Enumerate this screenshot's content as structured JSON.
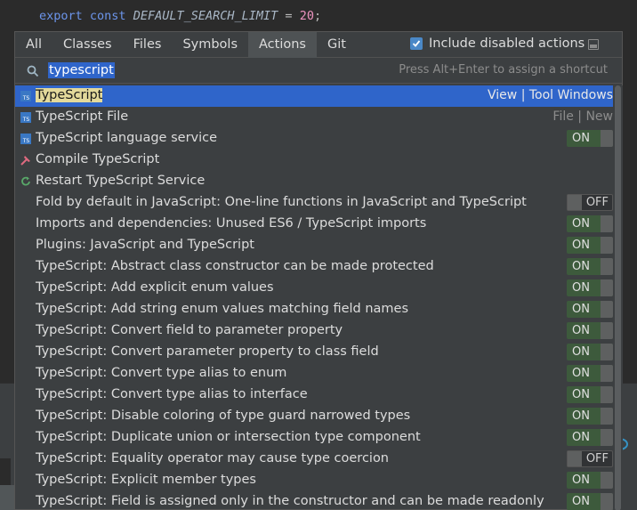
{
  "editor": {
    "keyword1": "export",
    "keyword2": "const",
    "const_name": "DEFAULT_SEARCH_LIMIT",
    "operator": "=",
    "value": "20",
    "terminator": ";"
  },
  "tabs": [
    {
      "label": "All"
    },
    {
      "label": "Classes"
    },
    {
      "label": "Files"
    },
    {
      "label": "Symbols"
    },
    {
      "label": "Actions",
      "active": true
    },
    {
      "label": "Git"
    }
  ],
  "include_disabled": {
    "label": "Include disabled actions",
    "checked": true
  },
  "search": {
    "value": "typescript",
    "hint": "Press Alt+Enter to assign a shortcut"
  },
  "items": [
    {
      "label": "TypeScript",
      "right": "View | Tool Windows",
      "icon": "ts-icon",
      "selected": true,
      "highlight": true
    },
    {
      "label": "TypeScript File",
      "right": "File | New",
      "icon": "ts-file-icon"
    },
    {
      "label": "TypeScript language service",
      "toggle": "ON",
      "icon": "ts-icon"
    },
    {
      "label": "Compile TypeScript",
      "icon": "hammer-icon"
    },
    {
      "label": "Restart TypeScript Service",
      "icon": "restart-icon"
    },
    {
      "label": "Fold by default in JavaScript: One-line functions in JavaScript and TypeScript",
      "toggle": "OFF"
    },
    {
      "label": "Imports and dependencies: Unused ES6 / TypeScript imports",
      "toggle": "ON"
    },
    {
      "label": "Plugins: JavaScript and TypeScript",
      "toggle": "ON"
    },
    {
      "label": "TypeScript: Abstract class constructor can be made protected",
      "toggle": "ON"
    },
    {
      "label": "TypeScript: Add explicit enum values",
      "toggle": "ON"
    },
    {
      "label": "TypeScript: Add string enum values matching field names",
      "toggle": "ON"
    },
    {
      "label": "TypeScript: Convert field to parameter property",
      "toggle": "ON"
    },
    {
      "label": "TypeScript: Convert parameter property to class field",
      "toggle": "ON"
    },
    {
      "label": "TypeScript: Convert type alias to enum",
      "toggle": "ON"
    },
    {
      "label": "TypeScript: Convert type alias to interface",
      "toggle": "ON"
    },
    {
      "label": "TypeScript: Disable coloring of type guard narrowed types",
      "toggle": "ON"
    },
    {
      "label": "TypeScript: Duplicate union or intersection type component",
      "toggle": "ON"
    },
    {
      "label": "TypeScript: Equality operator may cause type coercion",
      "toggle": "OFF"
    },
    {
      "label": "TypeScript: Explicit member types",
      "toggle": "ON"
    },
    {
      "label": "TypeScript: Field is assigned only in the constructor and can be made readonly",
      "toggle": "ON"
    }
  ],
  "colors": {
    "selection": "#2f65ca",
    "toggle_on": "#3d5a3c",
    "popup_bg": "#3c3f41",
    "editor_bg": "#2b2b2b",
    "match_highlight": "#e3d99b"
  }
}
